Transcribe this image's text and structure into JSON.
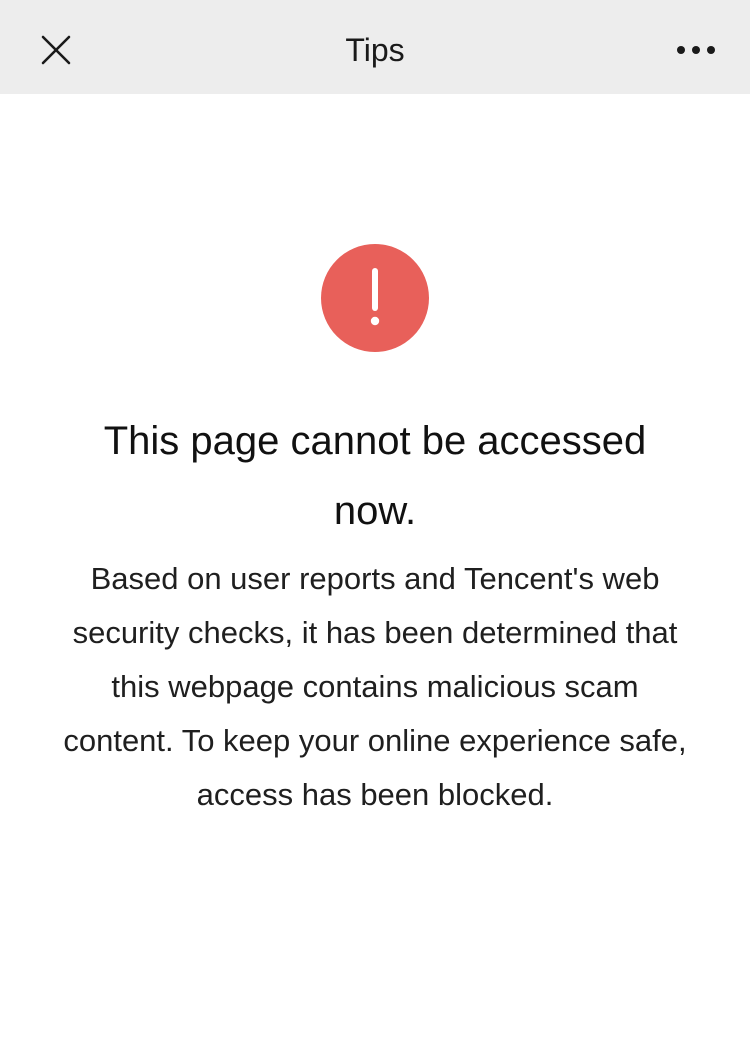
{
  "header": {
    "title": "Tips",
    "close_icon": "close-icon",
    "more_icon": "more-icon"
  },
  "alert": {
    "icon": "exclamation-icon",
    "color": "#E8605A",
    "heading": "This page cannot be accessed now.",
    "message": "Based on user reports and Tencent's web security checks, it has been determined that this webpage contains malicious scam content. To keep your online experience safe, access has been blocked."
  }
}
